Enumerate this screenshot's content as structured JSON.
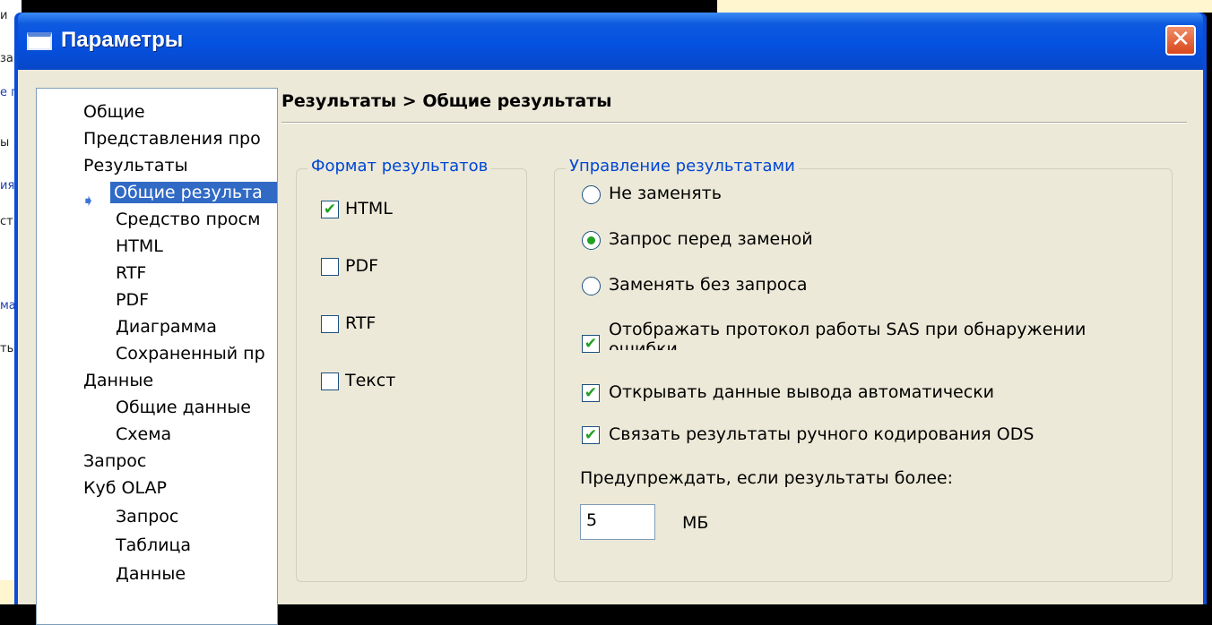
{
  "window": {
    "title": "Параметры",
    "close_glyph": "✕"
  },
  "background": {
    "left_fragments": [
      "и",
      "за",
      "е г",
      "ы",
      "ия",
      "ст",
      "ма",
      "ть"
    ]
  },
  "nav": {
    "items": [
      {
        "label": "Общие"
      },
      {
        "label": "Представления про"
      },
      {
        "label": "Результаты"
      },
      {
        "label": "Общие результа",
        "selected": true
      },
      {
        "label": "Средство просм"
      },
      {
        "label": "HTML"
      },
      {
        "label": "RTF"
      },
      {
        "label": "PDF"
      },
      {
        "label": "Диаграмма"
      },
      {
        "label": "Сохраненный пр"
      },
      {
        "label": "Данные"
      },
      {
        "label": "Общие данные"
      },
      {
        "label": "Схема"
      },
      {
        "label": "Запрос"
      },
      {
        "label": "Куб OLAP"
      },
      {
        "label": "Запрос"
      },
      {
        "label": "Таблица"
      },
      {
        "label": "Данные"
      }
    ],
    "selected_marker": "➧"
  },
  "pane": {
    "breadcrumb": "Результаты > Общие результаты",
    "format_group": {
      "title": "Формат результатов",
      "options": [
        {
          "label": "HTML",
          "checked": true
        },
        {
          "label": "PDF",
          "checked": false
        },
        {
          "label": "RTF",
          "checked": false
        },
        {
          "label": "Текст",
          "checked": false
        }
      ]
    },
    "manage_group": {
      "title": "Управление результатами",
      "radios": [
        {
          "label": "Не заменять",
          "selected": false
        },
        {
          "label": "Запрос перед заменой",
          "selected": true
        },
        {
          "label": "Заменять без запроса",
          "selected": false
        }
      ],
      "checks": [
        {
          "label": "Отображать протокол работы SAS при обнаружении ошибки",
          "checked": true
        },
        {
          "label": "Открывать данные вывода автоматически",
          "checked": true
        },
        {
          "label": "Связать результаты ручного кодирования ODS",
          "checked": true
        }
      ],
      "warn_label": "Предупреждать, если результаты более:",
      "warn_value": "5",
      "warn_unit": "МБ"
    }
  },
  "colors": {
    "title_blue": "#0551e0",
    "face": "#ece9d8",
    "selection": "#316ac5",
    "group_label": "#0046d5"
  }
}
